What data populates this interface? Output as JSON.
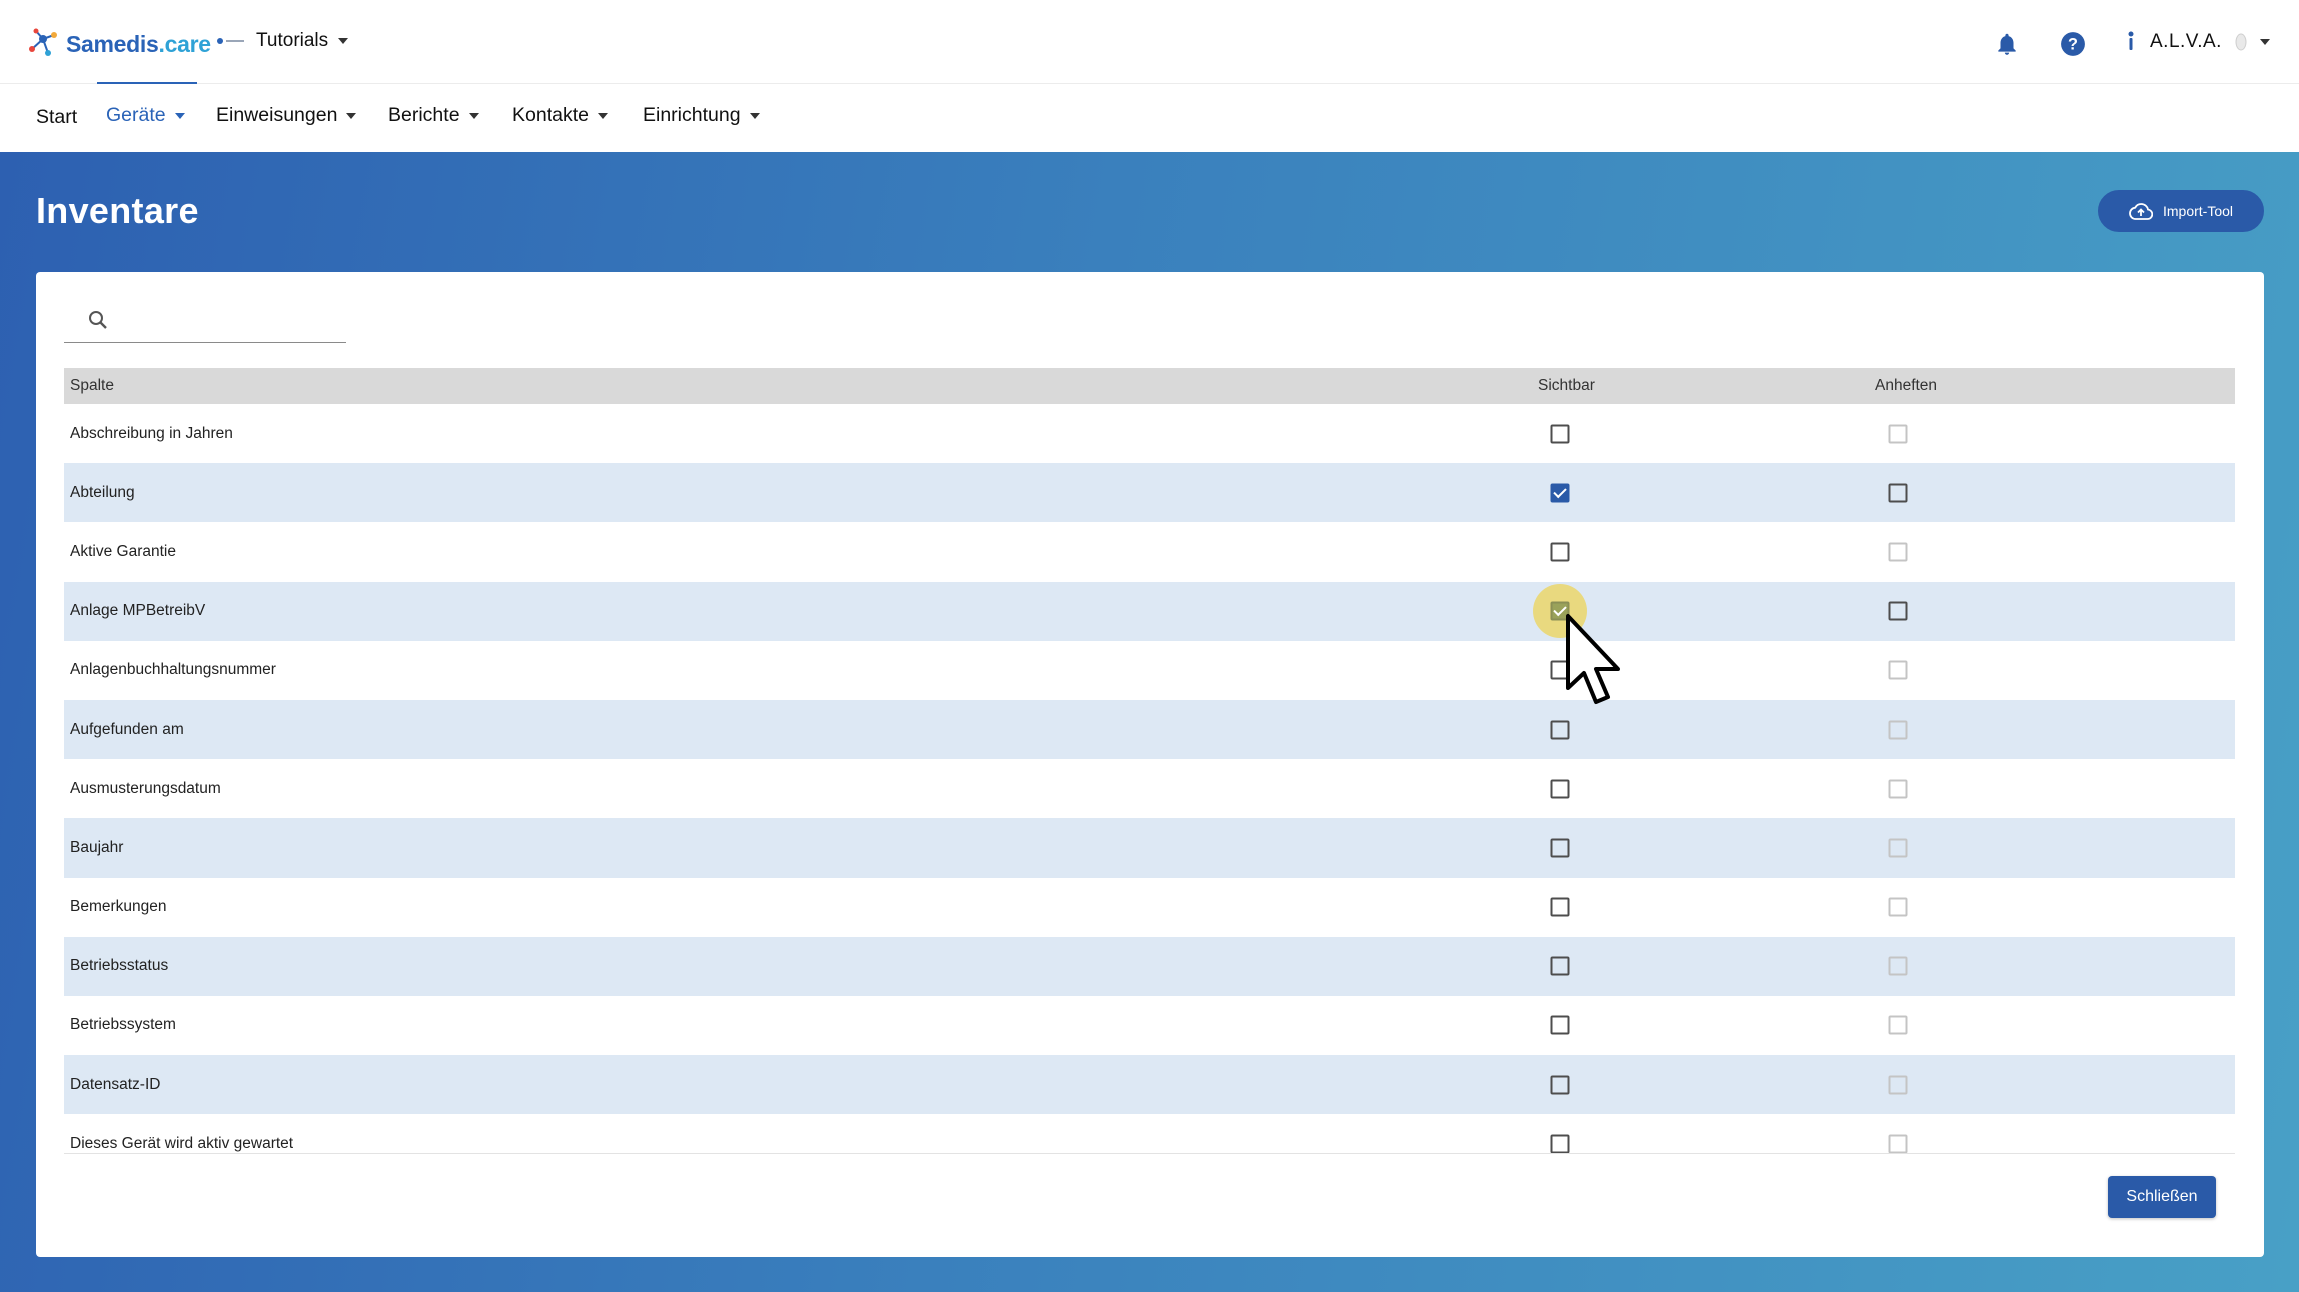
{
  "app": {
    "logo_brand": "Samedis",
    "logo_suffix": ".care",
    "tenant_name": "Tutorials",
    "user_name": "A.L.V.A."
  },
  "nav": {
    "items": [
      {
        "label": "Start",
        "active": false,
        "has_caret": false
      },
      {
        "label": "Geräte",
        "active": true,
        "has_caret": true
      },
      {
        "label": "Einweisungen",
        "active": false,
        "has_caret": true
      },
      {
        "label": "Berichte",
        "active": false,
        "has_caret": true
      },
      {
        "label": "Kontakte",
        "active": false,
        "has_caret": true
      },
      {
        "label": "Einrichtung",
        "active": false,
        "has_caret": true
      }
    ]
  },
  "page": {
    "title": "Inventare",
    "import_button": "Import-Tool"
  },
  "search": {
    "placeholder": "",
    "value": ""
  },
  "table": {
    "headers": {
      "column": "Spalte",
      "visible": "Sichtbar",
      "pin": "Anheften"
    },
    "rows": [
      {
        "label": "Abschreibung in Jahren",
        "visible": false,
        "pinned": false,
        "pin_enabled": false
      },
      {
        "label": "Abteilung",
        "visible": true,
        "pinned": false,
        "pin_enabled": true
      },
      {
        "label": "Aktive Garantie",
        "visible": false,
        "pinned": false,
        "pin_enabled": false
      },
      {
        "label": "Anlage MPBetreibV",
        "visible": true,
        "pinned": false,
        "pin_enabled": true,
        "highlighted": true
      },
      {
        "label": "Anlagenbuchhaltungsnummer",
        "visible": false,
        "pinned": false,
        "pin_enabled": false
      },
      {
        "label": "Aufgefunden am",
        "visible": false,
        "pinned": false,
        "pin_enabled": false
      },
      {
        "label": "Ausmusterungsdatum",
        "visible": false,
        "pinned": false,
        "pin_enabled": false
      },
      {
        "label": "Baujahr",
        "visible": false,
        "pinned": false,
        "pin_enabled": false
      },
      {
        "label": "Bemerkungen",
        "visible": false,
        "pinned": false,
        "pin_enabled": false
      },
      {
        "label": "Betriebsstatus",
        "visible": false,
        "pinned": false,
        "pin_enabled": false
      },
      {
        "label": "Betriebssystem",
        "visible": false,
        "pinned": false,
        "pin_enabled": false
      },
      {
        "label": "Datensatz-ID",
        "visible": false,
        "pinned": false,
        "pin_enabled": false
      },
      {
        "label": "Dieses Gerät wird aktiv gewartet",
        "visible": false,
        "pinned": false,
        "pin_enabled": false
      }
    ]
  },
  "footer": {
    "close_button": "Schließen"
  },
  "colors": {
    "brand_blue": "#2a63b7",
    "button_blue": "#2a5aa8",
    "row_alt": "#dde8f4",
    "highlight": "#ecd458"
  }
}
